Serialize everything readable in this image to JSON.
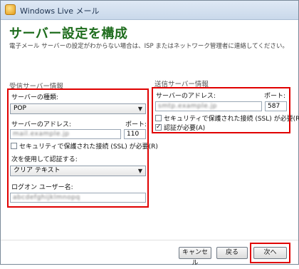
{
  "window": {
    "title": "Windows Live メール"
  },
  "page": {
    "heading": "サーバー設定を構成",
    "description": "電子メール サーバーの設定がわからない場合は、ISP またはネットワーク管理者に連絡してください。"
  },
  "incoming": {
    "section_title": "受信サーバー情報",
    "server_type_label": "サーバーの種類:",
    "server_type_value": "POP",
    "server_address_label": "サーバーのアドレス:",
    "server_address_value": "mail.example.jp",
    "port_label": "ポート:",
    "port_value": "110",
    "ssl_label": "セキュリティで保護された接続 (SSL) が必要(R)",
    "ssl_checked": false,
    "auth_label": "次を使用して認証する:",
    "auth_value": "クリア テキスト",
    "logon_label": "ログオン ユーザー名:",
    "logon_value": "abcdefghijklmnopq"
  },
  "outgoing": {
    "section_title": "送信サーバー情報",
    "server_address_label": "サーバーのアドレス:",
    "server_address_value": "smtp.example.jp",
    "port_label": "ポート:",
    "port_value": "587",
    "ssl_label": "セキュリティで保護された接続 (SSL) が必要(R)",
    "ssl_checked": false,
    "auth_required_label": "認証が必要(A)",
    "auth_required_checked": true
  },
  "buttons": {
    "cancel": "キャンセル",
    "back": "戻る",
    "next": "次へ"
  },
  "colors": {
    "heading": "#1f6d1e",
    "highlight": "#e00000"
  }
}
